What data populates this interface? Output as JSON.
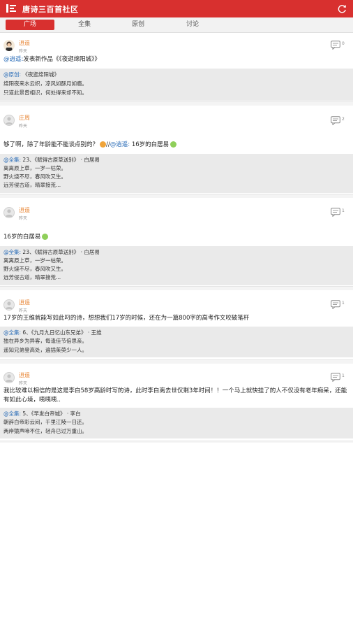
{
  "app": {
    "title": "唐诗三百首社区"
  },
  "tabs": [
    {
      "label": "广场"
    },
    {
      "label": "全集"
    },
    {
      "label": "原创"
    },
    {
      "label": "讨论"
    }
  ],
  "posts": [
    {
      "user": "逍遥",
      "time": "昨天",
      "comments": "0",
      "text_mention": "@逍遥:",
      "text": "发表新作品《《夜逛绵阳城》》",
      "quote": {
        "mention": "@原创:",
        "head": "《夜逛绵阳城》",
        "lines": [
          "绵阳夜来水云织，凉风如酥月如瘾。",
          "只道此景曾相识，何处得来却不知。"
        ]
      }
    },
    {
      "user": "庄周",
      "time": "昨天",
      "comments": "2",
      "text": "够了啊，除了年龄能不能谈点别的？",
      "text2_sep": "//",
      "text2_mention": "@逍遥:",
      "text2": " 16岁的白居易",
      "quote": {
        "mention": "@全集:",
        "head": "23、《赋得古原草送别》 · 白居易",
        "lines": [
          "离离原上草，一岁一枯荣。",
          "野火烧不尽，春风吹又生。",
          "远芳侵古道，晴翠接荒..."
        ]
      }
    },
    {
      "user": "逍遥",
      "time": "昨天",
      "comments": "1",
      "text": "16岁的白居易",
      "quote": {
        "mention": "@全集:",
        "head": "23、《赋得古原草送别》 · 白居易",
        "lines": [
          "离离原上草，一岁一枯荣。",
          "野火烧不尽，春风吹又生。",
          "远芳侵古道，晴翠接荒..."
        ]
      }
    },
    {
      "user": "逍遥",
      "time": "昨天",
      "comments": "1",
      "text": "17岁的王维就能写如此叼的诗，想想我们17岁的时候，还在为一篇800字的高考作文咬破笔杆",
      "quote": {
        "mention": "@全集:",
        "head": "6、《九月九日忆山东兄弟》 · 王维",
        "lines": [
          "独在异乡为异客，每逢佳节倍思亲。",
          "遥知兄弟登高处，遍插茱萸少一人。"
        ]
      }
    },
    {
      "user": "逍遥",
      "time": "昨天",
      "comments": "1",
      "text": "我比较难以相信的是这是李白58岁高龄时写的诗，此时李白离去世仅剩3年时间！！一个马上就快挂了的人不仅没有老年痴呆，还能有如此心境，咦咦咦..",
      "quote": {
        "mention": "@全集:",
        "head": "5、《早发白帝城》 · 李白",
        "lines": [
          "朝辞白帝彩云间，千里江陵一日还。",
          "两岸猿声啼不住，轻舟已过万重山。"
        ]
      }
    }
  ]
}
